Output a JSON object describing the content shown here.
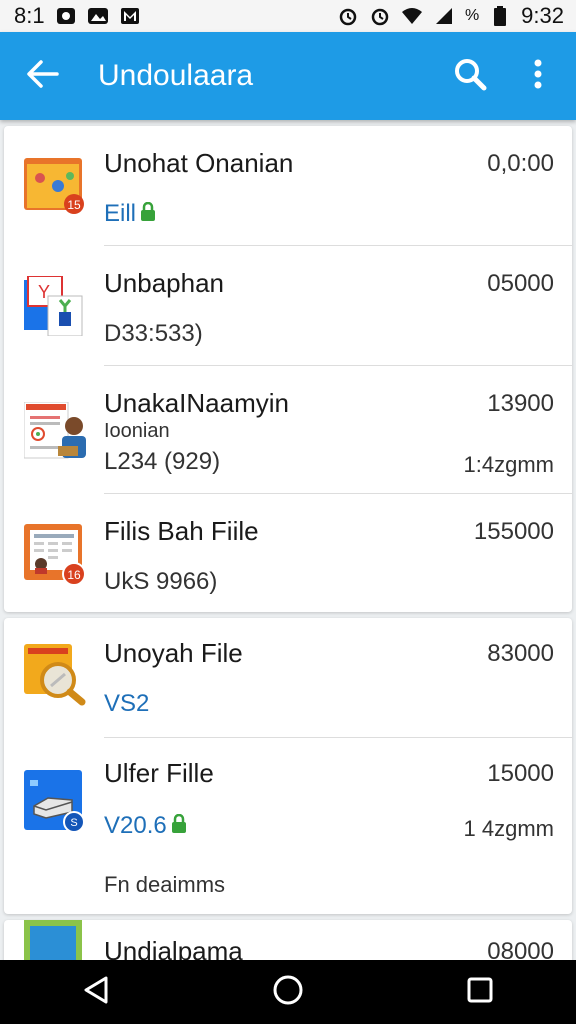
{
  "status_bar": {
    "time_left": "8:1",
    "time_right": "9:32",
    "battery_text": "%",
    "icons": [
      "image-icon",
      "photo-icon",
      "gmail-icon",
      "alarm-icon",
      "alarm-icon",
      "wifi-icon",
      "signal-icon",
      "battery-icon"
    ]
  },
  "app_bar": {
    "title": "Undoulaara",
    "back_icon": "arrow-back-icon",
    "actions": [
      "search-icon",
      "more-vert-icon"
    ],
    "color": "#1e9be6"
  },
  "files": [
    {
      "title": "Unohat Onanian",
      "value": "0,0:00",
      "sub": "Eill",
      "sub_color": "#1e6fb8",
      "has_lock": true,
      "icon": "file-thumbnail-icon"
    },
    {
      "title": "Unbaphan",
      "value": "05000",
      "sub": "D33:533)",
      "icon": "document-plant-icon"
    },
    {
      "title": "UnakaINaamyin",
      "value": "13900",
      "extra": "Ioonian",
      "sub": "L234 (929)",
      "meta": "1:4zgmm",
      "icon": "document-person-icon"
    },
    {
      "title": "Filis Bah Fiile",
      "value": "155000",
      "sub": "UkS 9966)",
      "icon": "spreadsheet-file-icon"
    },
    {
      "title": "Unoyah File",
      "value": "83000",
      "sub": "VS2",
      "sub_color": "#1e6fb8",
      "icon": "search-file-icon"
    },
    {
      "title": "Ulfer Fille",
      "value": "15000",
      "sub": "V20.6",
      "sub_color": "#1e6fb8",
      "has_lock": true,
      "meta": "1 4zgmm",
      "footer": "Fn deaimms",
      "icon": "drive-file-icon"
    },
    {
      "title": "Undialpama",
      "value": "08000",
      "icon": "green-file-icon"
    }
  ],
  "nav_bar": {
    "buttons": [
      "back-triangle-icon",
      "home-circle-icon",
      "recents-square-icon"
    ]
  }
}
